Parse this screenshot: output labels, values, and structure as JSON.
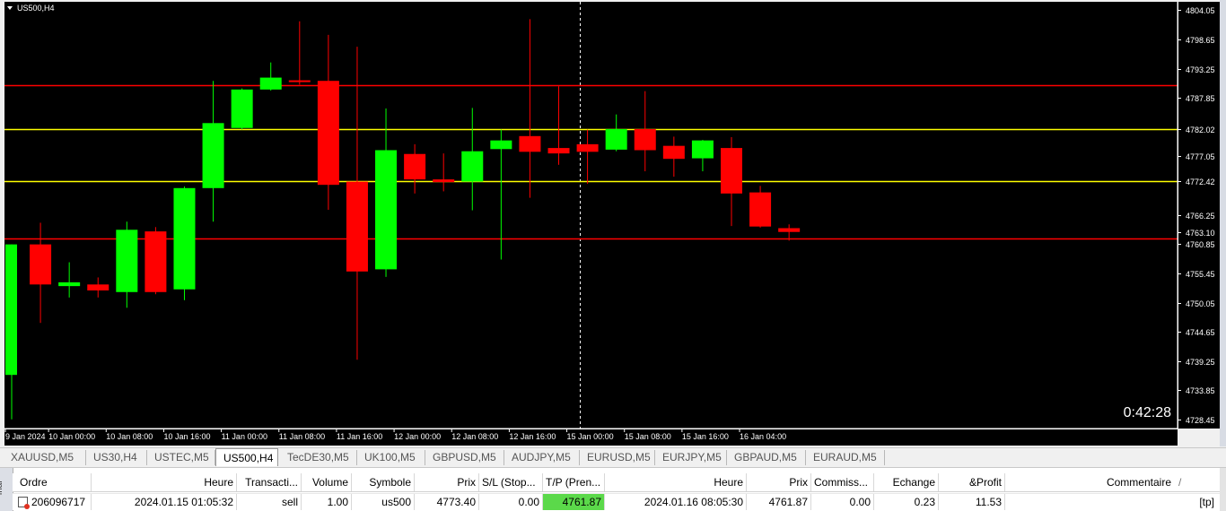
{
  "chart": {
    "symbol_label": "US500,H4",
    "timer": "0:42:28",
    "price_range": [
      4726.8,
      4805.6
    ],
    "price_ticks": [
      "4804.05",
      "4798.65",
      "4793.25",
      "4787.85",
      "4782.02",
      "4777.05",
      "4772.42",
      "4766.25",
      "4763.10",
      "4760.85",
      "4755.45",
      "4750.05",
      "4744.65",
      "4739.25",
      "4733.85",
      "4728.45"
    ],
    "time_labels": [
      "9 Jan 2024",
      "10 Jan 00:00",
      "10 Jan 08:00",
      "10 Jan 16:00",
      "11 Jan 00:00",
      "11 Jan 08:00",
      "11 Jan 16:00",
      "12 Jan 00:00",
      "12 Jan 08:00",
      "12 Jan 16:00",
      "15 Jan 00:00",
      "15 Jan 08:00",
      "15 Jan 16:00",
      "16 Jan 04:00"
    ],
    "hlines": [
      {
        "price": 4790.17,
        "label": "4790.17",
        "color": "#ff0000"
      },
      {
        "price": 4782.02,
        "label": "4782.02",
        "color": "#ffff00"
      },
      {
        "price": 4772.42,
        "label": "4772.42",
        "color": "#ffff00"
      },
      {
        "price": 4761.87,
        "label": "4761.87",
        "color": "#ff0000"
      }
    ],
    "bull_color": "#00ff00",
    "bear_color": "#ff0000",
    "candles": [
      {
        "o": 4736.7,
        "h": 4760.8,
        "l": 4728.5,
        "c": 4760.8
      },
      {
        "o": 4760.8,
        "h": 4764.8,
        "l": 4746.3,
        "c": 4753.4
      },
      {
        "o": 4753.1,
        "h": 4757.5,
        "l": 4751.0,
        "c": 4753.8
      },
      {
        "o": 4753.4,
        "h": 4754.7,
        "l": 4751.0,
        "c": 4752.3
      },
      {
        "o": 4752.0,
        "h": 4765.0,
        "l": 4749.1,
        "c": 4763.5
      },
      {
        "o": 4763.2,
        "h": 4764.0,
        "l": 4751.6,
        "c": 4752.0
      },
      {
        "o": 4752.5,
        "h": 4771.5,
        "l": 4750.5,
        "c": 4771.2
      },
      {
        "o": 4771.2,
        "h": 4791.0,
        "l": 4765.0,
        "c": 4783.2
      },
      {
        "o": 4782.3,
        "h": 4789.6,
        "l": 4782.0,
        "c": 4789.4
      },
      {
        "o": 4789.4,
        "h": 4794.4,
        "l": 4789.2,
        "c": 4791.6
      },
      {
        "o": 4791.1,
        "h": 4802.0,
        "l": 4790.3,
        "c": 4790.8
      },
      {
        "o": 4791.0,
        "h": 4799.5,
        "l": 4767.2,
        "c": 4771.8
      },
      {
        "o": 4772.4,
        "h": 4797.3,
        "l": 4739.5,
        "c": 4755.8
      },
      {
        "o": 4756.2,
        "h": 4785.9,
        "l": 4754.8,
        "c": 4778.2
      },
      {
        "o": 4777.5,
        "h": 4779.3,
        "l": 4770.2,
        "c": 4772.8
      },
      {
        "o": 4772.8,
        "h": 4777.6,
        "l": 4770.6,
        "c": 4772.3
      },
      {
        "o": 4772.4,
        "h": 4786.0,
        "l": 4767.1,
        "c": 4778.0
      },
      {
        "o": 4778.4,
        "h": 4782.0,
        "l": 4758.0,
        "c": 4780.0
      },
      {
        "o": 4780.8,
        "h": 4802.4,
        "l": 4769.4,
        "c": 4777.9
      },
      {
        "o": 4778.6,
        "h": 4790.0,
        "l": 4775.5,
        "c": 4777.6
      },
      {
        "o": 4779.3,
        "h": 4782.0,
        "l": 4772.0,
        "c": 4777.9
      },
      {
        "o": 4778.3,
        "h": 4784.8,
        "l": 4778.0,
        "c": 4782.1
      },
      {
        "o": 4782.1,
        "h": 4789.1,
        "l": 4774.3,
        "c": 4778.2
      },
      {
        "o": 4779.0,
        "h": 4780.7,
        "l": 4773.3,
        "c": 4776.6
      },
      {
        "o": 4776.7,
        "h": 4780.1,
        "l": 4774.3,
        "c": 4780.0
      },
      {
        "o": 4778.6,
        "h": 4780.6,
        "l": 4764.2,
        "c": 4770.2
      },
      {
        "o": 4770.4,
        "h": 4771.6,
        "l": 4763.9,
        "c": 4764.1
      },
      {
        "o": 4763.8,
        "h": 4764.5,
        "l": 4761.5,
        "c": 4763.1
      }
    ]
  },
  "tabs": {
    "items": [
      "XAUUSD,M5",
      "US30,H4",
      "USTEC,M5",
      "US500,H4",
      "TecDE30,M5",
      "UK100,M5",
      "GBPUSD,M5",
      "AUDJPY,M5",
      "EURUSD,M5",
      "EURJPY,M5",
      "GBPAUD,M5",
      "EURAUD,M5"
    ],
    "active": "US500,H4"
  },
  "terminal": {
    "side_label": "inal",
    "headers": {
      "ordre": "Ordre",
      "heure": "Heure",
      "transaction": "Transacti...",
      "volume": "Volume",
      "symbole": "Symbole",
      "prix": "Prix",
      "sl": "S/L (Stop...",
      "tp": "T/P (Pren...",
      "heure2": "Heure",
      "prix2": "Prix",
      "commission": "Commiss...",
      "echange": "Echange",
      "profit": "&Profit",
      "commentaire": "Commentaire",
      "sort_mark": "/"
    },
    "row": {
      "ordre": "206096717",
      "heure": "2024.01.15 01:05:32",
      "transaction": "sell",
      "volume": "1.00",
      "symbole": "us500",
      "prix": "4773.40",
      "sl": "0.00",
      "tp": "4761.87",
      "heure2": "2024.01.16 08:05:30",
      "prix2": "4761.87",
      "commission": "0.00",
      "echange": "0.23",
      "profit": "11.53",
      "commentaire": "[tp]"
    }
  }
}
